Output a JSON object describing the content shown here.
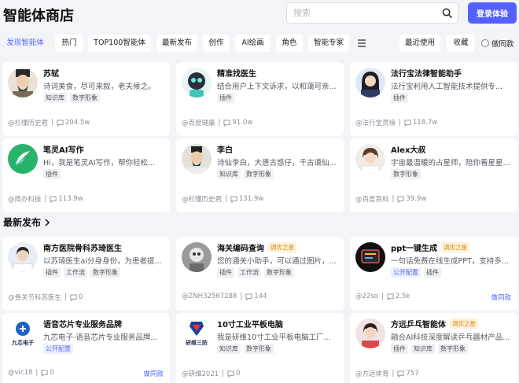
{
  "header": {
    "title": "智能体商店",
    "search_placeholder": "搜索",
    "login_label": "登录体验"
  },
  "tabs": [
    {
      "label": "发现智能体",
      "active": true
    },
    {
      "label": "热门"
    },
    {
      "label": "TOP100智能体"
    },
    {
      "label": "最新发布"
    },
    {
      "label": "创作"
    },
    {
      "label": "AI绘画"
    },
    {
      "label": "角色"
    },
    {
      "label": "智能专家"
    }
  ],
  "right_tabs": {
    "recent": "最近使用",
    "favorite": "收藏",
    "become_creator": "做同款"
  },
  "section_latest": "最新发布",
  "do_same": "做同款",
  "cards": [
    {
      "name": "苏轼",
      "desc": "诗词美食，尽可来叙，老夫候之。",
      "tags": [
        "知识库",
        "数字形象"
      ],
      "author": "@杉懂历史君",
      "views": "204.5w"
    },
    {
      "name": "精准找医生",
      "desc": "结合用户上下文诉求，以和蔼可亲...",
      "tags": [
        "插件"
      ],
      "author": "@百度健康",
      "views": "91.0w"
    },
    {
      "name": "法行宝法律智能助手",
      "desc": "法行宝利用人工智能技术提供专...",
      "tags": [
        "插件"
      ],
      "author": "@法行宝灵境",
      "views": "118.7w"
    },
    {
      "name": "笔灵AI写作",
      "desc": "Hi，我是笔灵AI写作，帮你轻松...",
      "tags": [
        "插件"
      ],
      "author": "@简办科技",
      "views": "113.9w"
    },
    {
      "name": "李白",
      "desc": "诗仙李白，大唐古惑仔，千古谪仙...",
      "tags": [
        "知识库",
        "数字形象"
      ],
      "author": "@杉懂历史君",
      "views": "131.9w"
    },
    {
      "name": "Alex大叔",
      "desc": "宇宙最温暖的占星师，陪你看星星...",
      "tags": [
        "数字形象"
      ],
      "author": "@百度百科",
      "views": "39.9w"
    },
    {
      "name": "南方医院骨科苏琦医生",
      "desc": "以苏琦医生ai分身身份，为患者提...",
      "tags": [
        "插件",
        "工作流",
        "数字形象"
      ],
      "author": "@骨关节科苏医生",
      "views": "0"
    },
    {
      "name": "海关编码查询",
      "badge": "调优之星",
      "desc": "您的通关小助手，可以通过图片，...",
      "tags": [
        "插件",
        "工作流",
        "数字形象"
      ],
      "author": "@ZNH32567288",
      "views": "144"
    },
    {
      "name": "ppt一键生成",
      "badge": "调优之星",
      "desc": "一句话免费在线生成PPT，支持多...",
      "tags": [
        "公开配置",
        "插件"
      ],
      "author": "@22so",
      "views": "2.5k",
      "same": true
    },
    {
      "name": "语音芯片专业服务品牌",
      "desc": "九芯电子-语音芯片专业服务品牌...",
      "tags": [
        "公开配置"
      ],
      "author": "@vic18",
      "views": "0",
      "same": true
    },
    {
      "name": "10寸工业平板电脑",
      "desc": "我是研维10寸工业平板电脑工厂...",
      "tags": [
        "知识库",
        "数字形象"
      ],
      "author": "@研维2021",
      "views": "0"
    },
    {
      "name": "方远乒乓智能体",
      "badge": "调优之星",
      "desc": "融合AI科技深度解读乒乓器材产品...",
      "tags": [
        "插件",
        "知识库",
        "数字形象"
      ],
      "author": "@方远体育",
      "views": "757"
    }
  ],
  "logo_texts": {
    "jiuxin": "九芯电子",
    "yanwei": "研维三防"
  },
  "colors": {
    "accent": "#5460ff",
    "star": "#d68a16",
    "link": "#4f67ff"
  }
}
